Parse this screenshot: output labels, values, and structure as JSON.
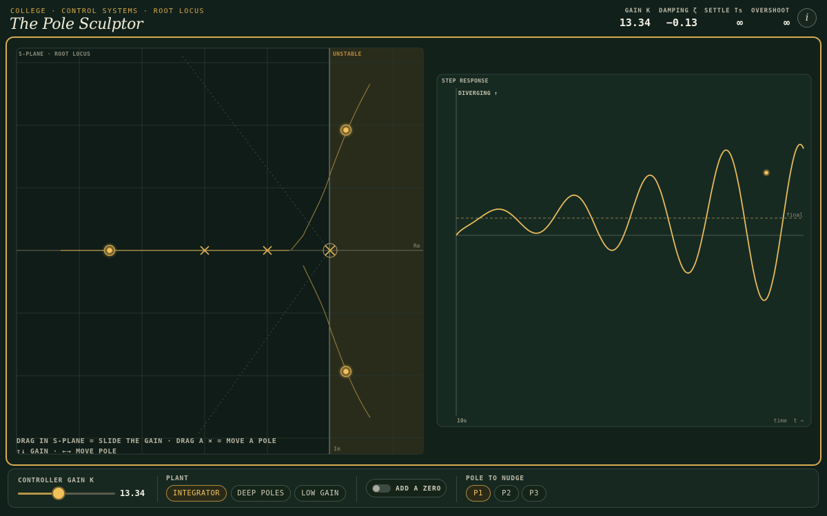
{
  "header": {
    "breadcrumb": "COLLEGE · CONTROL SYSTEMS · ROOT LOCUS",
    "title": "The Pole Sculptor",
    "stats": [
      {
        "label": "GAIN K",
        "value": "13.34"
      },
      {
        "label": "DAMPING ζ",
        "value": "−0.13"
      },
      {
        "label": "SETTLE Ts",
        "value": "∞"
      },
      {
        "label": "OVERSHOOT",
        "value": "∞"
      }
    ],
    "info_icon": "info-icon"
  },
  "splane": {
    "title": "S-PLANE · ROOT LOCUS",
    "unstable_label": "UNSTABLE",
    "re_label": "Re",
    "im_label": "Im",
    "hint_line1": "DRAG IN S-PLANE = SLIDE THE GAIN · DRAG A × = MOVE A POLE",
    "hint_line2": "↑↓ GAIN · ←→ MOVE POLE"
  },
  "step": {
    "title": "STEP RESPONSE",
    "status": "DIVERGING ↑",
    "final_label": "final",
    "t_start": "10s",
    "t_axis": "time  t →"
  },
  "controls": {
    "gain_label": "CONTROLLER GAIN K",
    "gain_value": "13.34",
    "gain_fraction": 0.42,
    "plant_label": "PLANT",
    "plants": [
      {
        "label": "INTEGRATOR",
        "active": true
      },
      {
        "label": "DEEP POLES",
        "active": false
      },
      {
        "label": "LOW GAIN",
        "active": false
      }
    ],
    "zero_label": "ADD A ZERO",
    "zero_on": false,
    "nudge_label": "POLE TO NUDGE",
    "nudge": [
      {
        "label": "P1",
        "active": true
      },
      {
        "label": "P2",
        "active": false
      },
      {
        "label": "P3",
        "active": false
      }
    ]
  },
  "colors": {
    "accent": "#d8ad52",
    "locus": "#a48a47",
    "response": "#f2c25a",
    "unstable_fill": "#2c2d1b"
  }
}
